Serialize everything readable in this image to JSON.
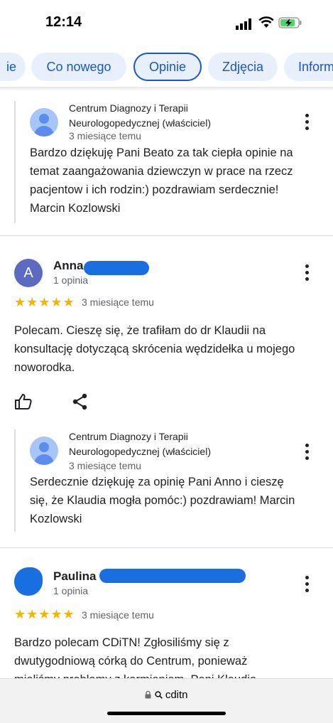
{
  "status_bar": {
    "time": "12:14"
  },
  "chips": [
    {
      "label": "ie"
    },
    {
      "label": "Co nowego"
    },
    {
      "label": "Opinie"
    },
    {
      "label": "Zdjęcia"
    },
    {
      "label": "Inform"
    }
  ],
  "reviews": [
    {
      "owner_reply": {
        "name_line1": "Centrum Diagnozy i Terapii",
        "name_line2": "Neurologopedycznej (właściciel)",
        "time": "3 miesiące temu",
        "text_lines": [
          "Bardzo dziękuję Pani Beato za tak ciepła opinie na",
          "temat zaangażowania dziewczyn w prace na rzecz",
          "pacjentow i ich rodzin:) pozdrawiam serdecznie!",
          "Marcin Kozlowski"
        ]
      }
    },
    {
      "author": "Anna",
      "avatar_letter": "A",
      "count": "1 opinia",
      "stars": "★★★★★",
      "rating": 5,
      "time": "3 miesiące temu",
      "text_lines": [
        "Polecam. Cieszę się, że trafiłam do dr Klaudii na",
        "konsultację dotyczącą skrócenia wędzidełka u mojego",
        "noworodka."
      ],
      "owner_reply": {
        "name_line1": "Centrum Diagnozy i Terapii",
        "name_line2": "Neurologopedycznej (właściciel)",
        "time": "3 miesiące temu",
        "text_lines": [
          "Serdecznie dziękuję za opinię Pani Anno i cieszę",
          "się, że Klaudia mogła pomóc:) pozdrawiam! Marcin",
          "Kozlowski"
        ]
      }
    },
    {
      "author": "Paulina",
      "count": "1 opinia",
      "stars": "★★★★★",
      "rating": 5,
      "time": "3 miesiące temu",
      "text_lines": [
        "Bardzo polecam CDiTN! Zgłosiliśmy się z",
        "dwutygodniową córką do Centrum, ponieważ",
        "mieliśmy problemy z karmieniem. Pani Klaudia"
      ]
    }
  ],
  "browser": {
    "url": "cditn",
    "lock_icon": "lock-icon",
    "search_icon": "search-icon"
  },
  "colors": {
    "accent": "#1a56c8",
    "chip_bg": "#e8f0fe",
    "star": "#f4b400",
    "redaction": "#1a6fe0"
  }
}
